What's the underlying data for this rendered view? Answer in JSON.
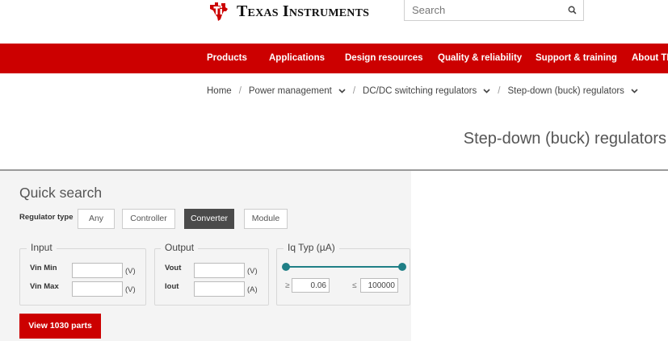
{
  "brand": {
    "name": "Texas Instruments",
    "logo_color": "#cc0000"
  },
  "search": {
    "placeholder": "Search",
    "icon": "search-icon"
  },
  "nav": {
    "items": [
      {
        "label": "Products"
      },
      {
        "label": "Applications"
      },
      {
        "label": "Design resources"
      },
      {
        "label": "Quality & reliability"
      },
      {
        "label": "Support & training"
      },
      {
        "label": "About TI"
      }
    ],
    "bg_color": "#cc0000"
  },
  "breadcrumb": {
    "items": [
      {
        "label": "Home"
      },
      {
        "label": "Power management"
      },
      {
        "label": "DC/DC switching regulators"
      },
      {
        "label": "Step-down (buck) regulators"
      }
    ],
    "separator": "/"
  },
  "page": {
    "title": "Step-down (buck) regulators"
  },
  "quick_search": {
    "title": "Quick search",
    "regulator_type": {
      "label": "Regulator type",
      "options": [
        "Any",
        "Controller",
        "Converter",
        "Module"
      ],
      "selected": "Converter"
    },
    "input": {
      "legend": "Input",
      "vin_min_label": "Vin Min",
      "vin_min_value": "",
      "vin_min_unit": "(V)",
      "vin_max_label": "Vin Max",
      "vin_max_value": "",
      "vin_max_unit": "(V)"
    },
    "output": {
      "legend": "Output",
      "vout_label": "Vout",
      "vout_value": "",
      "vout_unit": "(V)",
      "iout_label": "Iout",
      "iout_value": "",
      "iout_unit": "(A)"
    },
    "iq": {
      "legend": "Iq Typ (µA)",
      "min_symbol": "≥",
      "min_value": "0.06",
      "max_symbol": "≤",
      "max_value": "100000",
      "slider_color": "#1f7f86"
    },
    "view_button": "View 1030 parts"
  }
}
